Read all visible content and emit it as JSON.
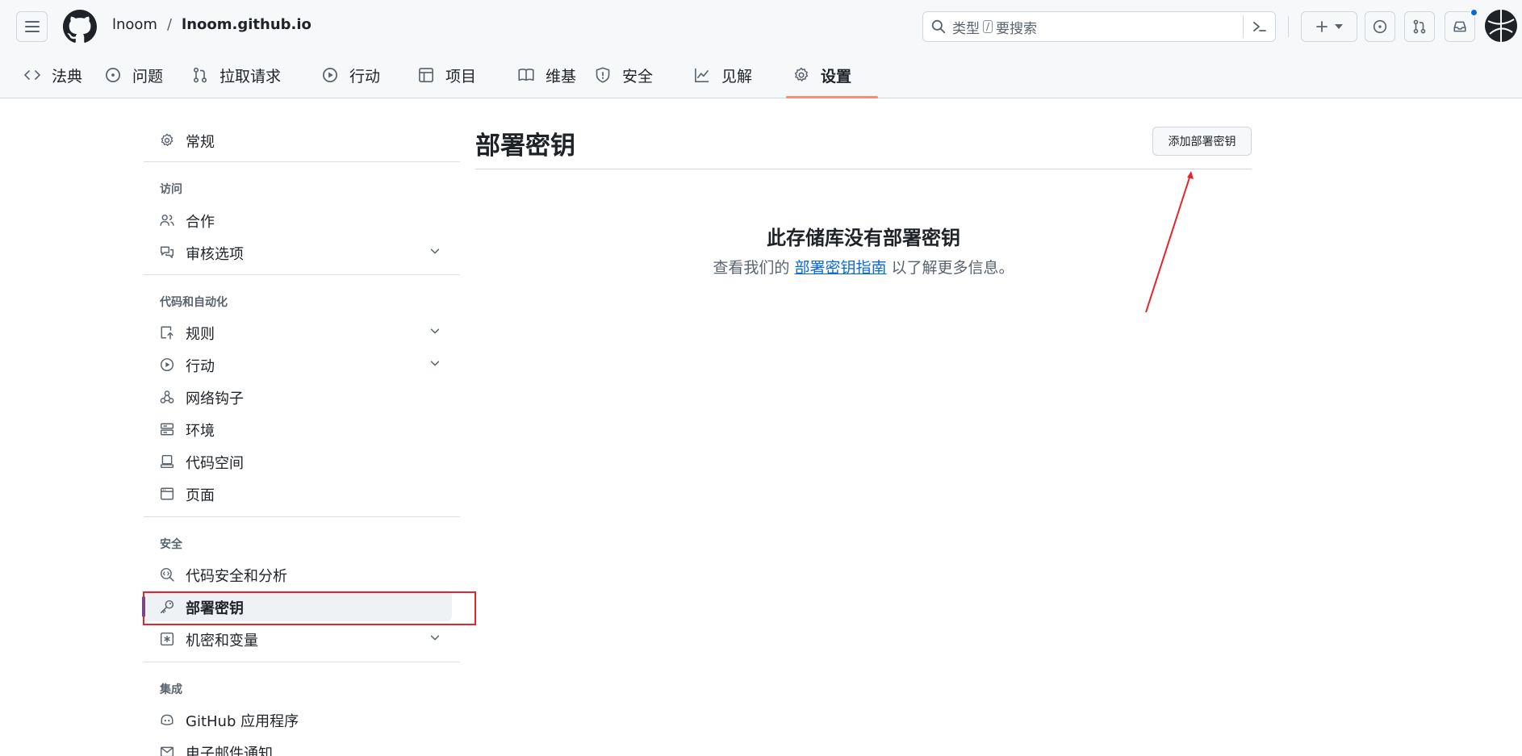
{
  "header": {
    "owner": "lnoom",
    "separator": "/",
    "repo": "lnoom.github.io",
    "search": {
      "placeholder_prefix": "类型",
      "slash_key": "/",
      "placeholder_suffix": "要搜索"
    },
    "icons": [
      "menu-icon",
      "github-logo-icon",
      "search-icon",
      "command-palette-icon",
      "plus-icon",
      "issue-icon",
      "pull-request-icon",
      "inbox-icon",
      "avatar"
    ]
  },
  "tabs": [
    {
      "label": "法典",
      "icon": "code-icon"
    },
    {
      "label": "问题",
      "icon": "issue-icon"
    },
    {
      "label": "拉取请求",
      "icon": "pull-request-icon"
    },
    {
      "label": "行动",
      "icon": "play-icon"
    },
    {
      "label": "项目",
      "icon": "table-icon"
    },
    {
      "label": "维基",
      "icon": "book-icon"
    },
    {
      "label": "安全",
      "icon": "shield-icon"
    },
    {
      "label": "见解",
      "icon": "graph-icon"
    },
    {
      "label": "设置",
      "icon": "gear-icon",
      "active": true
    }
  ],
  "sidebar": {
    "general": "常规",
    "access_heading": "访问",
    "collaborators": "合作",
    "moderation": "审核选项",
    "code_heading": "代码和自动化",
    "rules": "规则",
    "actions": "行动",
    "webhooks": "网络钩子",
    "environments": "环境",
    "codespaces": "代码空间",
    "pages": "页面",
    "security_heading": "安全",
    "code_security": "代码安全和分析",
    "deploy_keys": "部署密钥",
    "secrets": "机密和变量",
    "integrations_heading": "集成",
    "github_apps": "GitHub 应用程序",
    "email_notifications": "电子邮件通知"
  },
  "main": {
    "title": "部署密钥",
    "add_button": "添加部署密钥",
    "empty_title": "此存储库没有部署密钥",
    "empty_prefix": "查看我们的",
    "empty_link": "部署密钥指南",
    "empty_suffix": "以了解更多信息。"
  },
  "colors": {
    "accent_blue": "#0969da",
    "tab_underline": "#fd8c73",
    "annotation_red": "#e5242c",
    "notification_dot": "#0969da"
  }
}
